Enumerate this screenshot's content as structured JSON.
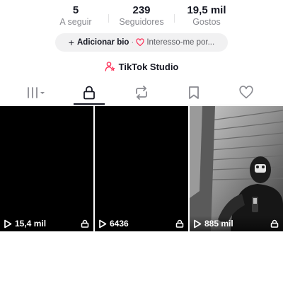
{
  "stats": [
    {
      "value": "5",
      "label": "A seguir"
    },
    {
      "value": "239",
      "label": "Seguidores"
    },
    {
      "value": "19,5 mil",
      "label": "Gostos"
    }
  ],
  "bio": {
    "add_label": "Adicionar bio",
    "separator": "·",
    "interests_label": "Interesso-me por..."
  },
  "studio": {
    "label": "TikTok Studio"
  },
  "tabs": [
    {
      "icon": "grid-icon",
      "selected": false
    },
    {
      "icon": "lock-icon",
      "selected": true
    },
    {
      "icon": "repost-icon",
      "selected": false
    },
    {
      "icon": "bookmark-icon",
      "selected": false
    },
    {
      "icon": "heart-icon",
      "selected": false
    }
  ],
  "videos": [
    {
      "views": "15,4 mil",
      "private": true,
      "thumbnail": "black"
    },
    {
      "views": "6436",
      "private": true,
      "thumbnail": "black"
    },
    {
      "views": "885 mil",
      "private": true,
      "thumbnail": "photo"
    }
  ],
  "colors": {
    "text_primary": "#161823",
    "text_secondary": "#8a8b91",
    "pill_bg": "#f1f1f2",
    "heart_accent": "#fe2c55"
  }
}
